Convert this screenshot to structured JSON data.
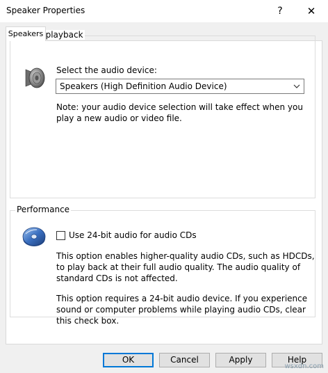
{
  "window": {
    "title": "Speaker Properties",
    "help_glyph": "?",
    "close_glyph": "✕"
  },
  "tabs": [
    {
      "label": "Speakers",
      "active": true
    }
  ],
  "sound_playback": {
    "group_label": "Sound playback",
    "select_label": "Select the audio device:",
    "selected_device": "Speakers (High Definition Audio Device)",
    "note": "Note: your audio device selection will take effect when you play a new audio or video file.",
    "icon": "speaker-icon"
  },
  "performance": {
    "group_label": "Performance",
    "checkbox_label": "Use 24-bit audio for audio CDs",
    "checkbox_checked": false,
    "description_1": "This option enables higher-quality audio CDs, such as HDCDs, to play back at their full audio quality. The audio quality of standard CDs is not affected.",
    "description_2": "This option requires a 24-bit audio device. If you experience sound or computer problems while playing audio CDs, clear this check box.",
    "icon": "cd-disc-icon"
  },
  "buttons": {
    "ok": "OK",
    "cancel": "Cancel",
    "apply": "Apply",
    "help": "Help"
  },
  "watermark": "wsxdn.com",
  "colors": {
    "accent": "#0078d7",
    "dialog_bg": "#f0f0f0"
  }
}
